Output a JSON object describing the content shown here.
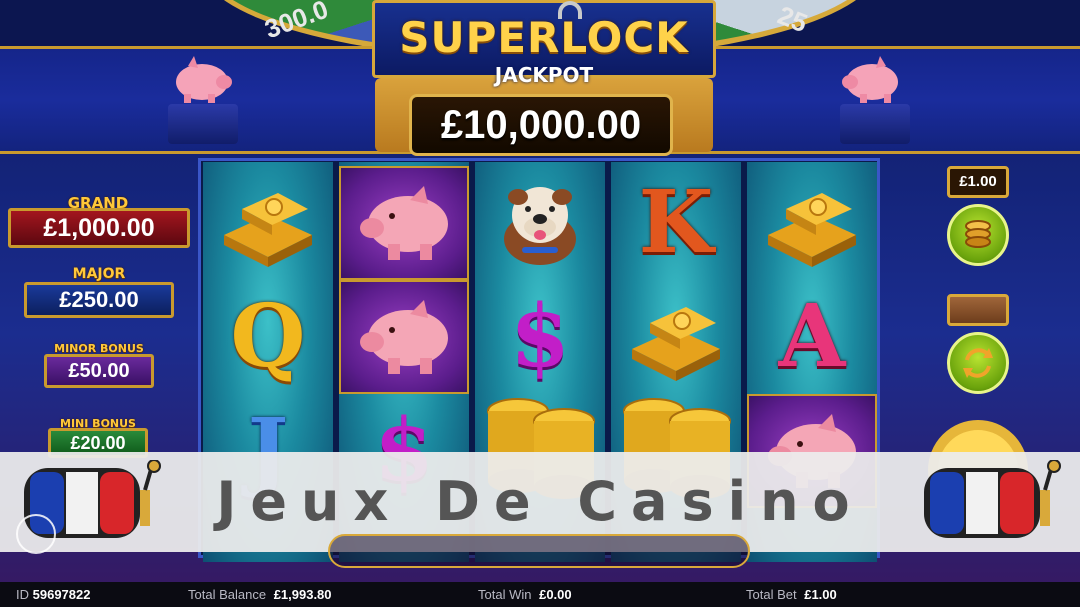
{
  "header": {
    "logo_title": "SUPERLOCK",
    "logo_subtitle": "JACKPOT",
    "jackpot_value": "£10,000.00",
    "wheel_values": [
      "300.0",
      "25"
    ]
  },
  "jackpot_tiers": [
    {
      "label": "GRAND",
      "value": "£1,000.00"
    },
    {
      "label": "MAJOR",
      "value": "£250.00"
    },
    {
      "label": "MINOR BONUS",
      "value": "£50.00"
    },
    {
      "label": "MINI BONUS",
      "value": "£20.00"
    }
  ],
  "reels": [
    [
      "gold-bars",
      "Q",
      "J"
    ],
    [
      "piggy-bank",
      "piggy-bank",
      "dollar"
    ],
    [
      "bulldog",
      "dollar",
      "gold-coins"
    ],
    [
      "K",
      "gold-bars",
      "gold-coins"
    ],
    [
      "gold-bars",
      "A",
      "piggy-bank"
    ]
  ],
  "controls": {
    "bet_value": "£1.00",
    "coins_icon": "coin-stack-icon",
    "autoplay_icon": "refresh-icon"
  },
  "overlay": {
    "title": "Jeux De Casino"
  },
  "status_bar": {
    "id_label": "ID",
    "id_value": "59697822",
    "balance_label": "Total Balance",
    "balance_value": "£1,993.80",
    "win_label": "Total Win",
    "win_value": "£0.00",
    "bet_label": "Total Bet",
    "bet_value": "£1.00"
  },
  "colors": {
    "gold": "#d9a93a",
    "reel_teal": "#1b8aa0",
    "purple_cell": "#5b1d8c",
    "grand_red": "#8a1018",
    "button_green": "#6aa30c"
  }
}
